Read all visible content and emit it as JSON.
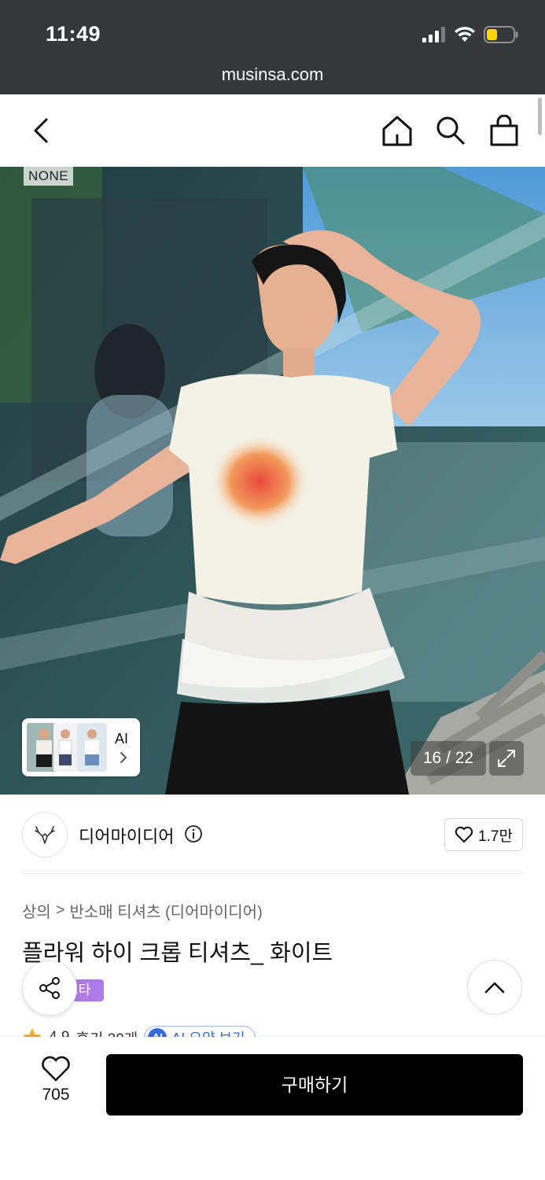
{
  "status_bar": {
    "time": "11:49"
  },
  "browser": {
    "url": "musinsa.com"
  },
  "hero": {
    "brand_tag": "NONE",
    "counter_current": "16",
    "counter_sep": " / ",
    "counter_total": "22",
    "thumb_label": "AI"
  },
  "brand": {
    "name": "디어마이디어",
    "likes": "1.7만"
  },
  "breadcrumb": {
    "category": "상의",
    "separator": ">",
    "subcategory": "반소매 티셔츠 (디어마이디어)"
  },
  "product": {
    "title": "플라워 하이 크롭 티셔츠_ 화이트",
    "badge": "스타"
  },
  "review": {
    "rating": "4.9",
    "count_label": "후기 20개",
    "ai_summary": "AI 요약 보기"
  },
  "bottom": {
    "wish_count": "705",
    "buy_label": "구매하기"
  },
  "colors": {
    "status_bg": "#35383a",
    "buy_bg": "#000000",
    "badge": "#b07ae6",
    "star": "#f5a623",
    "ai_blue": "#3a6ae0"
  }
}
